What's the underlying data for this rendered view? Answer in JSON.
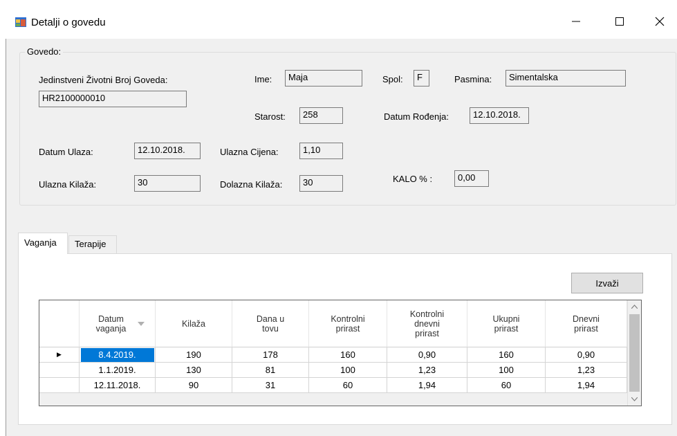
{
  "window": {
    "title": "Detalji o govedu",
    "minimize_glyph": "—",
    "maximize_glyph": "☐",
    "close_glyph": "✕"
  },
  "govedo": {
    "legend": "Govedo:",
    "jib_label": "Jedinstveni Životni Broj Goveda:",
    "jib_value": "HR2100000010",
    "ime_label": "Ime:",
    "ime_value": "Maja",
    "spol_label": "Spol:",
    "spol_value": "F",
    "pasmina_label": "Pasmina:",
    "pasmina_value": "Simentalska",
    "starost_label": "Starost:",
    "starost_value": "258",
    "datum_rodjenja_label": "Datum Rođenja:",
    "datum_rodjenja_value": "12.10.2018.",
    "datum_ulaza_label": "Datum Ulaza:",
    "datum_ulaza_value": "12.10.2018.",
    "ulazna_cijena_label": "Ulazna Cijena:",
    "ulazna_cijena_value": "1,10",
    "ulazna_kilaza_label": "Ulazna Kilaža:",
    "ulazna_kilaza_value": "30",
    "dolazna_kilaza_label": "Dolazna Kilaža:",
    "dolazna_kilaza_value": "30",
    "kalo_label": "KALO % :",
    "kalo_value": "0,00"
  },
  "tabs": [
    {
      "label": "Vaganja",
      "selected": true
    },
    {
      "label": "Terapije",
      "selected": false
    }
  ],
  "izvazi_label": "Izvaži",
  "grid": {
    "columns": [
      {
        "label": "Datum vaganja",
        "sort_icon": "sort-arrow-icon"
      },
      {
        "label": "Kilaža"
      },
      {
        "label": "Dana u tovu"
      },
      {
        "label": "Kontrolni prirast"
      },
      {
        "label": "Kontrolni dnevni prirast"
      },
      {
        "label": "Ukupni prirast"
      },
      {
        "label": "Dnevni prirast"
      }
    ],
    "rows": [
      [
        "8.4.2019.",
        "190",
        "178",
        "160",
        "0,90",
        "160",
        "0,90"
      ],
      [
        "1.1.2019.",
        "130",
        "81",
        "100",
        "1,23",
        "100",
        "1,23"
      ],
      [
        "12.11.2018.",
        "90",
        "31",
        "60",
        "1,94",
        "60",
        "1,94"
      ]
    ],
    "current_row_marker": "▶",
    "selection_color": "#0078d7"
  }
}
